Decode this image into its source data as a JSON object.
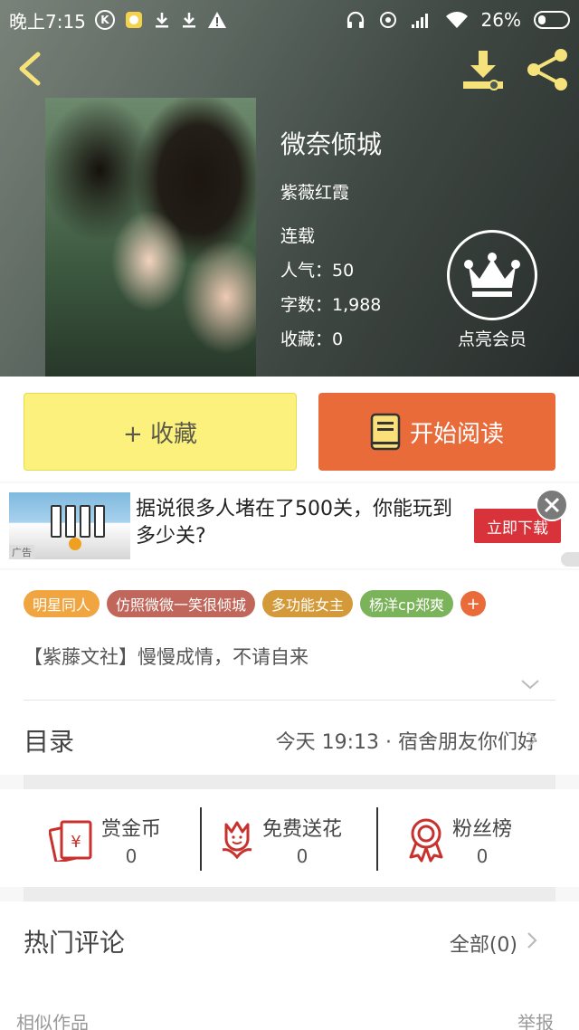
{
  "status_bar": {
    "time": "晚上7:15",
    "battery_percent": "26%",
    "k_badge": "K"
  },
  "book": {
    "title": "微奈倾城",
    "author": "紫薇红霞",
    "status": "连载",
    "popularity": "人气：50",
    "word_count": "字数：1,988",
    "favorites": "收藏：0"
  },
  "vip": {
    "label": "点亮会员"
  },
  "actions": {
    "collect_label": "+ 收藏",
    "read_label": "开始阅读"
  },
  "ad": {
    "text": "据说很多人堵在了500关，你能玩到多少关?",
    "button_label": "立即下载",
    "badge": "广告"
  },
  "tags": [
    {
      "label": "明星同人",
      "color": "#f0a540"
    },
    {
      "label": "仿照微微一笑很倾城",
      "color": "#c0665a"
    },
    {
      "label": "多功能女主",
      "color": "#d49a3a"
    },
    {
      "label": "杨洋cp郑爽",
      "color": "#7bb35a"
    }
  ],
  "tag_more": "+",
  "intro": "【紫藤文社】慢慢成情，不请自来",
  "catalog": {
    "label": "目录",
    "latest": "今天 19:13 · 宿舍朋友你们好"
  },
  "support": [
    {
      "label": "赏金币",
      "value": "0",
      "icon": "coin-envelope-icon"
    },
    {
      "label": "免费送花",
      "value": "0",
      "icon": "flower-icon"
    },
    {
      "label": "粉丝榜",
      "value": "0",
      "icon": "medal-icon"
    }
  ],
  "comments": {
    "title": "热门评论",
    "all_label": "全部(0)"
  },
  "footer": {
    "similar": "相似作品",
    "report": "举报"
  },
  "colors": {
    "accent_orange": "#e96b3a",
    "collect_yellow": "#fcf17c",
    "icon_yellow": "#f6e27a",
    "support_red": "#c8322e"
  }
}
